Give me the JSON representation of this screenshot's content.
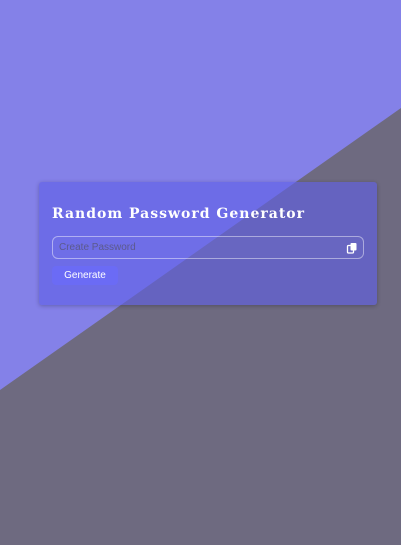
{
  "page": {
    "background_light": "#8481e8",
    "background_dark": "#6e6a80"
  },
  "card": {
    "title": "Random Password Generator",
    "input": {
      "value": "",
      "placeholder": "Create Password"
    },
    "copy_icon": "copy-icon",
    "generate_label": "Generate",
    "accent": "#6b6bf5"
  }
}
